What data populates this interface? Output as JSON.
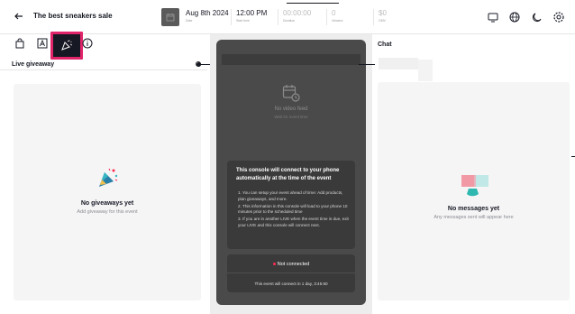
{
  "header": {
    "title": "The best sneakers sale",
    "date": {
      "value": "Aug 8th 2024",
      "label": "Date"
    },
    "start_time": {
      "value": "12:00 PM",
      "label": "Start time"
    },
    "duration": {
      "value": "00:00:00",
      "label": "Duration"
    },
    "viewers": {
      "value": "0",
      "label": "Viewers"
    },
    "gmv": {
      "value": "$0",
      "label": "GMV"
    }
  },
  "left_panel": {
    "title": "Live giveaway",
    "empty_title": "No giveaways yet",
    "empty_subtitle": "Add giveaway for this event"
  },
  "console": {
    "no_feed_title": "No video feed",
    "no_feed_subtitle": "Wait for event time",
    "info_title": "This console will connect to your phone automatically at the time of the event",
    "info_items": [
      "1. You can setup your event ahead of time: Add products, plan giveaways, and more.",
      "2. This information in this console will load to your phone 10 minutes prior to the scheduled time",
      "3. If you are in another LIVE when the event time is due, exit your LIVE and this console will connect next."
    ],
    "status": "Not connected",
    "countdown": "This event will connect in 1 day, 3:45:50"
  },
  "chat": {
    "title": "Chat",
    "empty_title": "No messages yet",
    "empty_subtitle": "Any messages sent will appear here"
  },
  "colors": {
    "highlight": "#e0246a",
    "status_dot": "#fe2c55",
    "phone_bg": "#4a4a4a"
  },
  "icons": {
    "back": "arrow-left-icon",
    "calendar": "calendar-icon",
    "monitor": "monitor-icon",
    "globe": "globe-icon",
    "theme": "moon-icon",
    "settings": "gear-icon",
    "products": "shopping-bag-icon",
    "text": "text-box-icon",
    "giveaway": "party-popper-icon",
    "info": "info-icon"
  }
}
